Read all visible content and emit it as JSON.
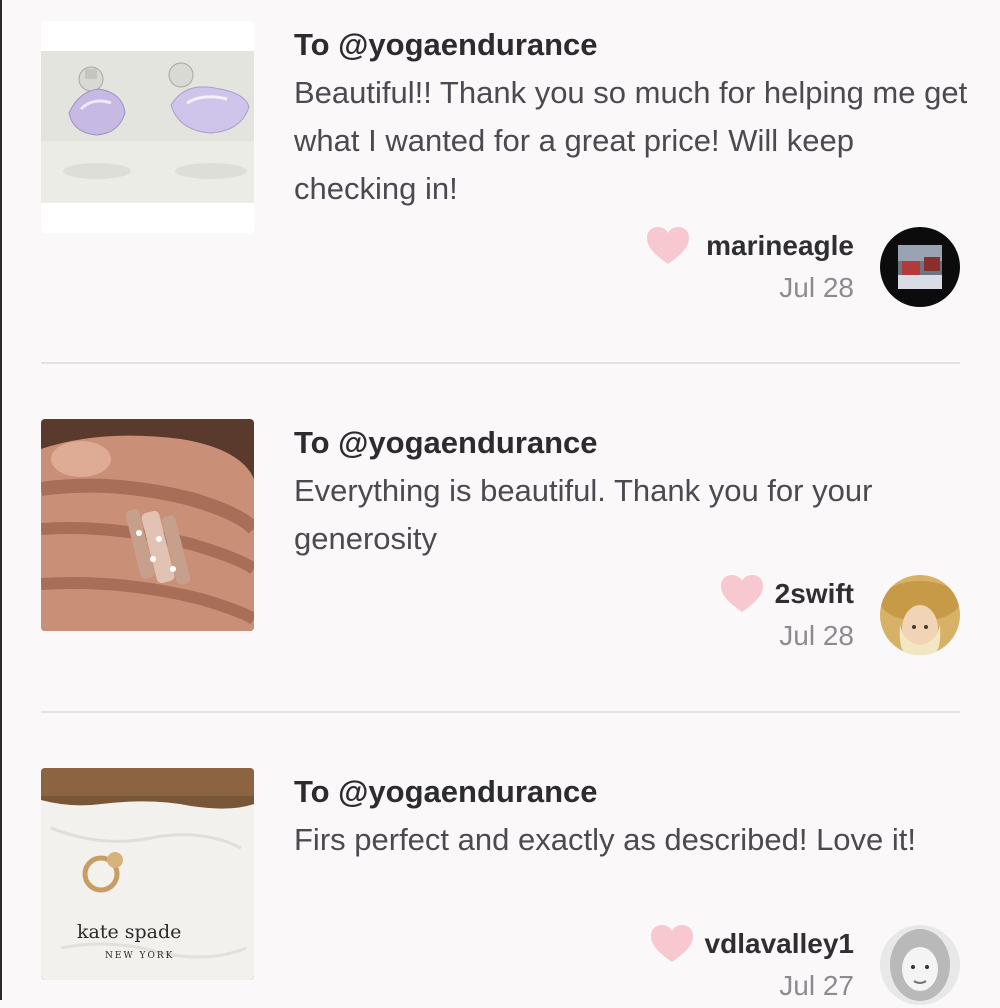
{
  "reviews": [
    {
      "recipient": "To @yogaendurance",
      "message": "Beautiful!! Thank you so much for helping me get what I wanted for a great price! Will keep checking in!",
      "username": "marineagle",
      "date": "Jul 28"
    },
    {
      "recipient": "To @yogaendurance",
      "message": "Everything is beautiful. Thank you for your generosity",
      "username": "2swift",
      "date": "Jul 28"
    },
    {
      "recipient": "To @yogaendurance",
      "message": "Firs perfect and exactly as described! Love it!",
      "username": "vdlavalley1",
      "date": "Jul 27",
      "thumbnail_text": [
        "kate spade",
        "NEW YORK"
      ]
    }
  ],
  "icons": {
    "like": "heart-icon"
  },
  "colors": {
    "heart": "#f7c8cf",
    "background": "#fbf8f9",
    "divider": "#e6e2e4"
  }
}
